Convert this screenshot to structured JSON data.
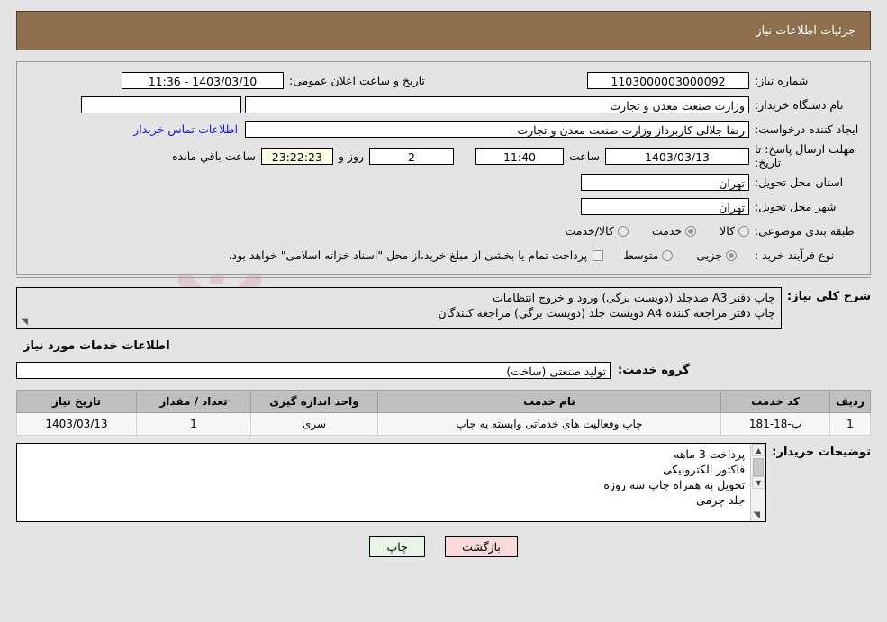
{
  "header": {
    "title": "جزئیات اطلاعات نیاز"
  },
  "form": {
    "need_number_label": "شماره نیاز:",
    "need_number_value": "1103000003000092",
    "announce_label": "تاریخ و ساعت اعلان عمومی:",
    "announce_value": "11:36 - 1403/03/10",
    "buyer_org_label": "نام دستگاه خریدار:",
    "buyer_org_value": "وزارت صنعت معدن و تجارت",
    "empty_field_value": "",
    "creator_label": "ایجاد کننده درخواست:",
    "creator_value": "رضا جلالی کاربرداز وزارت صنعت معدن و تجارت",
    "contact_link": "اطلاعات تماس خریدار",
    "deadline_label": "مهلت ارسال پاسخ: تا تاریخ:",
    "deadline_date": "1403/03/13",
    "hour_label": "ساعت",
    "deadline_time": "11:40",
    "days_value": "2",
    "days_label": "روز و",
    "countdown_value": "23:22:23",
    "remaining_label": "ساعت باقي مانده",
    "province_label": "استان محل تحویل:",
    "province_value": "تهران",
    "city_label": "شهر محل تحویل:",
    "city_value": "تهران",
    "category_label": "طبقه بندی موضوعی:",
    "category_options": [
      {
        "label": "کالا",
        "checked": false
      },
      {
        "label": "خدمت",
        "checked": true
      },
      {
        "label": "کالا/خدمت",
        "checked": false
      }
    ],
    "process_label": "نوع فرآیند خرید :",
    "process_options": [
      {
        "label": "جزیی",
        "checked": true
      },
      {
        "label": "متوسط",
        "checked": false
      }
    ],
    "treasury_checkbox_checked": false,
    "treasury_note": "پرداخت تمام یا بخشی از مبلغ خرید،از محل \"اسناد خزانه اسلامی\" خواهد بود."
  },
  "description": {
    "label": "شرح کلي نیاز:",
    "text": "چاپ دفتر  A3 صدجلد (دویست برگی) ورود و خروج انتظامات\nچاپ دفتر مراجعه کننده A4 دویست جلد (دویست برگی) مراجعه کنندگان"
  },
  "services_section": {
    "heading": "اطلاعات خدمات مورد نیاز",
    "group_label": "گروه خدمت:",
    "group_value": "تولید صنعتی (ساخت)"
  },
  "table": {
    "columns": [
      "ردیف",
      "کد خدمت",
      "نام خدمت",
      "واحد اندازه گیری",
      "تعداد / مقدار",
      "تاریخ نیاز"
    ],
    "rows": [
      {
        "row_no": "1",
        "service_code": "ب-18-181",
        "service_name": "چاپ وفعالیت های خدماتی وابسته به چاپ",
        "unit": "سری",
        "quantity": "1",
        "need_date": "1403/03/13"
      }
    ]
  },
  "comments": {
    "label": "توضیحات خریدار:",
    "text": "پرداخت 3 ماهه\nفاکتور الکترونیکی\nتحویل به همراه چاپ سه روزه\nجلد چرمی"
  },
  "buttons": {
    "print": "چاپ",
    "back": "بازگشت"
  },
  "watermark": {
    "text": "ArtaTender.net"
  },
  "icons": {
    "scroll_up": "▲",
    "scroll_down": "▼",
    "resize_grip": "◥"
  },
  "colors": {
    "header_bg": "#8d6e4d",
    "page_bg": "#e4e4e4",
    "link": "#1717d6",
    "timer_bg": "#fdfde8",
    "print_btn_bg": "#e7f5e7",
    "back_btn_bg": "#f9d9d9",
    "table_header_bg": "#bfbfbf"
  }
}
